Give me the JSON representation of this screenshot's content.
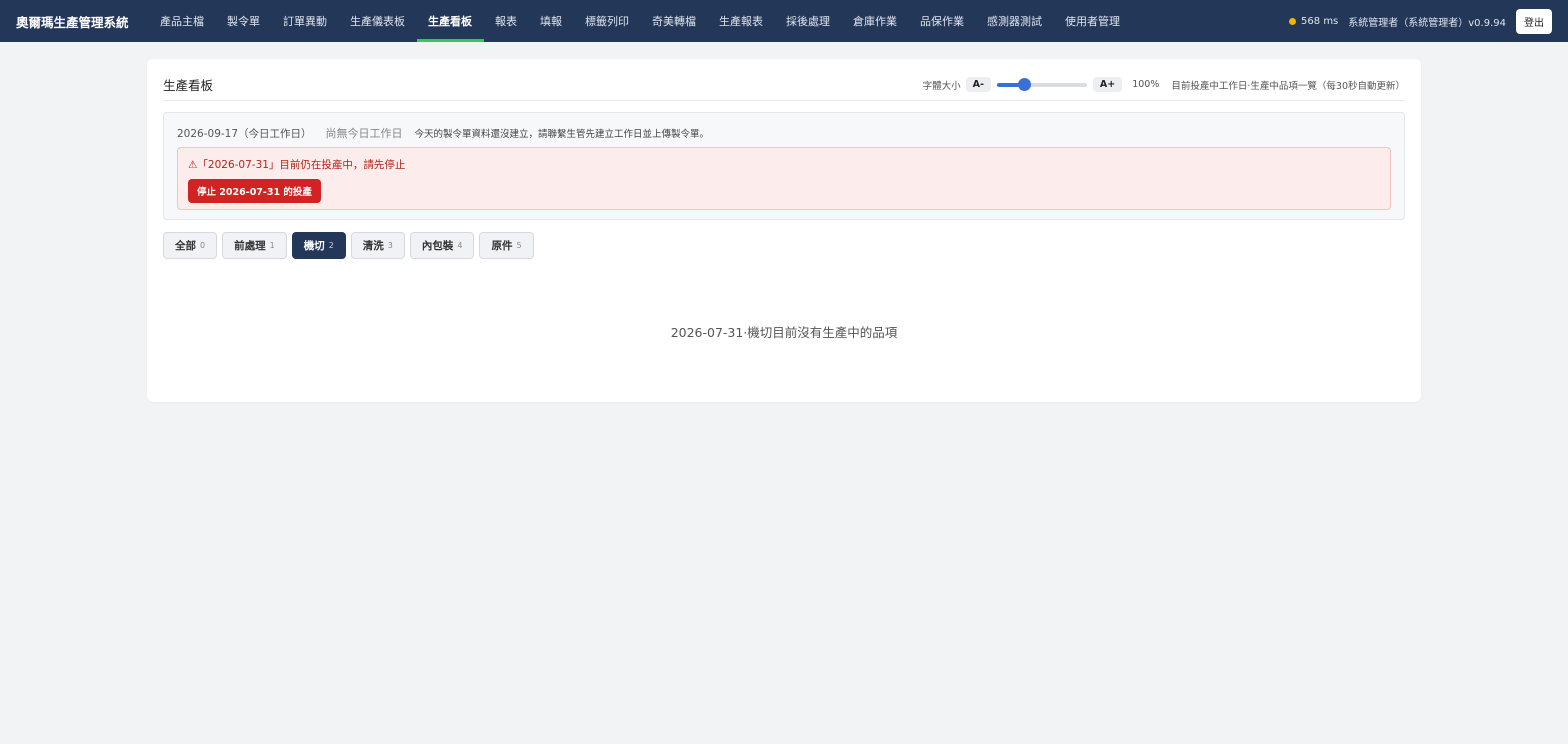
{
  "app": {
    "title": "奧爾瑪生產管理系統"
  },
  "nav": {
    "items": [
      {
        "label": "產品主檔"
      },
      {
        "label": "製令單"
      },
      {
        "label": "訂單異動"
      },
      {
        "label": "生產儀表板"
      },
      {
        "label": "生產看板",
        "active": true
      },
      {
        "label": "報表"
      },
      {
        "label": "填報"
      },
      {
        "label": "標籤列印"
      },
      {
        "label": "奇美轉檔"
      },
      {
        "label": "生產報表"
      },
      {
        "label": "採後處理"
      },
      {
        "label": "倉庫作業"
      },
      {
        "label": "品保作業"
      },
      {
        "label": "感測器測試"
      },
      {
        "label": "使用者管理"
      }
    ]
  },
  "header": {
    "latency": "568 ms",
    "latency_color": "#f5b400",
    "user": "系統管理者（系統管理者）v0.9.94",
    "logout_label": "登出"
  },
  "board": {
    "title": "生產看板",
    "font_size_label": "字體大小",
    "font_decrease_label": "A-",
    "font_increase_label": "A+",
    "font_scale_value": 0.3,
    "font_percent": "100%",
    "subtitle": "目前投產中工作日·生產中品項一覽（每30秒自動更新）"
  },
  "info": {
    "today_label": "2026-09-17（今日工作日）",
    "no_workday_label": "尚無今日工作日",
    "message": "今天的製令單資料還沒建立，請聯繫生管先建立工作日並上傳製令單。"
  },
  "alert": {
    "text": "⚠「2026-07-31」目前仍在投產中，請先停止",
    "button_label": "停止 2026-07-31 的投產",
    "color": "#d32222"
  },
  "tabs": [
    {
      "label": "全部",
      "count": "0"
    },
    {
      "label": "前處理",
      "count": "1"
    },
    {
      "label": "機切",
      "count": "2",
      "active": true
    },
    {
      "label": "清洗",
      "count": "3"
    },
    {
      "label": "內包裝",
      "count": "4"
    },
    {
      "label": "原件",
      "count": "5"
    }
  ],
  "empty_message": "2026-07-31·機切目前沒有生產中的品項",
  "colors": {
    "nav_bg": "#233759",
    "active_underline": "#34c759",
    "accent": "#3b6fd8"
  }
}
